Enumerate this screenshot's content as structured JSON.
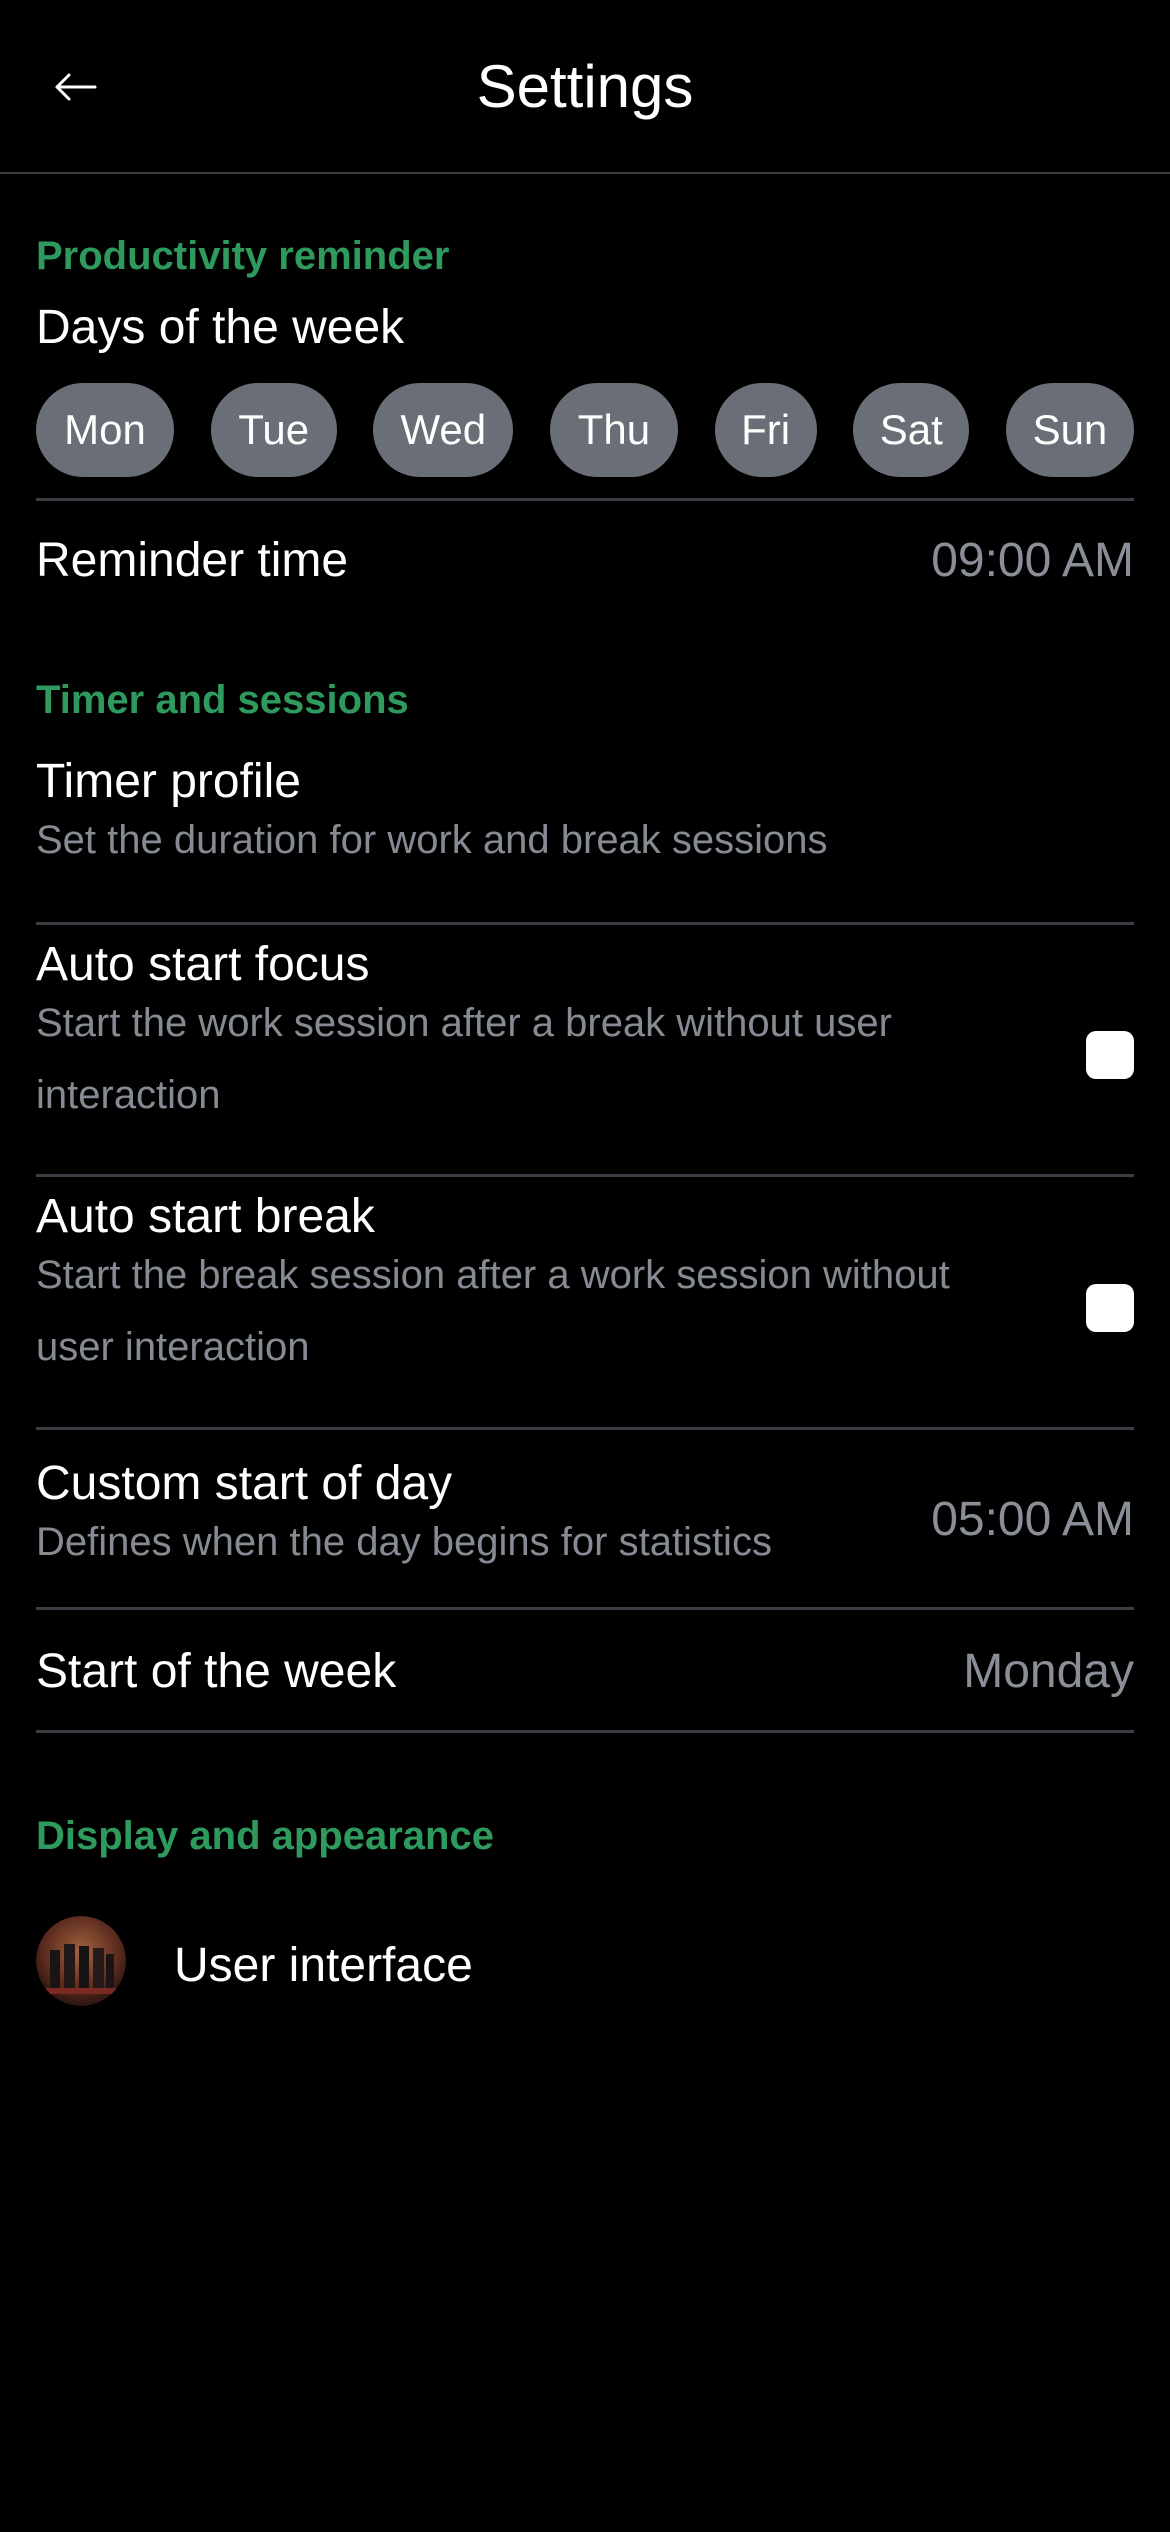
{
  "header": {
    "title": "Settings",
    "back_icon": "arrow-left-icon"
  },
  "productivity": {
    "section_title": "Productivity reminder",
    "days_label": "Days of the week",
    "days": [
      "Mon",
      "Tue",
      "Wed",
      "Thu",
      "Fri",
      "Sat",
      "Sun"
    ],
    "reminder_time_label": "Reminder time",
    "reminder_time_value": "09:00 AM"
  },
  "timer": {
    "section_title": "Timer and sessions",
    "timer_profile": {
      "title": "Timer profile",
      "subtitle": "Set the duration for work and break sessions"
    },
    "auto_start_focus": {
      "title": "Auto start focus",
      "subtitle_line1": "Start the work session after a break without user",
      "subtitle_line2": "interaction",
      "checked": false
    },
    "auto_start_break": {
      "title": "Auto start break",
      "subtitle_line1": "Start the break session after a work session without",
      "subtitle_line2": "user interaction",
      "checked": false
    },
    "custom_start_of_day": {
      "title": "Custom start of day",
      "subtitle": "Defines when the day begins for statistics",
      "value": "05:00 AM"
    },
    "start_of_week": {
      "title": "Start of the week",
      "value": "Monday"
    }
  },
  "display": {
    "section_title": "Display and appearance",
    "user_interface": {
      "title": "User interface",
      "icon": "user-interface-avatar-icon"
    }
  },
  "colors": {
    "accent": "#2e9a5e",
    "background": "#000000",
    "chip": "#6a6f77",
    "divider": "#3a3f46",
    "muted_text": "#868b93"
  }
}
